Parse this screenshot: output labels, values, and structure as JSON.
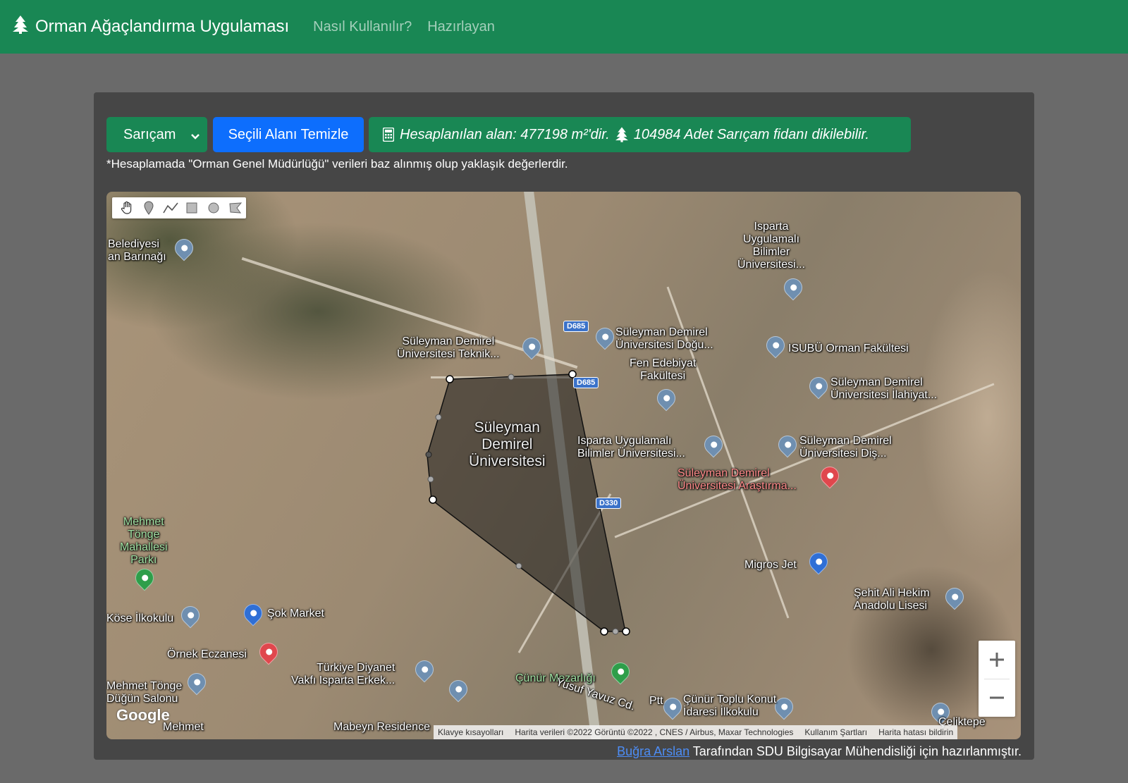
{
  "navbar": {
    "brand": "Orman Ağaçlandırma Uygulaması",
    "brand_icon": "tree-icon",
    "links": [
      "Nasıl Kullanılır?",
      "Hazırlayan"
    ],
    "color": "#198754"
  },
  "controls": {
    "species_selected": "Sarıçam",
    "clear_button": "Seçili Alanı Temizle",
    "info_area_text": "Hesaplanılan alan: 477198 m²'dir.",
    "info_count_text": "104984 Adet Sarıçam fidanı dikilebilir.",
    "info_icons": [
      "calculator-icon",
      "tree-icon"
    ],
    "note": "*Hesaplamada \"Orman Genel Müdürlüğü\" verileri baz alınmış olup yaklaşık değerlerdir."
  },
  "map": {
    "draw_tools": [
      "hand-icon",
      "marker-icon",
      "polyline-icon",
      "rectangle-icon",
      "circle-icon",
      "polygon-icon"
    ],
    "labels": {
      "belediyesi": "Belediyesi\nan Barınağı",
      "isparta_uyg": "Isparta\nUygulamalı\nBilimler\nÜniversitesi...",
      "sdu_teknik": "Süleyman Demirel\nÜniversitesi Teknik...",
      "sdu_dogu": "Süleyman Demirel\nÜniversitesi Doğu...",
      "isubu_orman": "ISUBÜ Orman Fakültesi",
      "fen_edebiyat": "Fen Edebiyat\nFakültesi",
      "sdu_ilahiyat": "Süleyman Demirel\nÜniversitesi İlahiyat...",
      "sdu_main": "Süleyman\nDemirel\nÜniversitesi",
      "isparta_uyg2": "Isparta Uygulamalı\nBilimler Üniversitesi...",
      "sdu_dis": "Süleyman Demirel\nÜniversitesi Diş...",
      "sdu_arastirma": "Süleyman Demirel\nÜniversitesi Araştırma...",
      "mehmet_tonge_park": "Mehmet\nTönge\nMahallesi\nParkı",
      "migros": "Migros Jet",
      "sehit_ali": "Şehit Ali Hekim\nAnadolu Lisesi",
      "kose_ilkokulu": "Köse İlkokulu",
      "sok_market": "Şok Market",
      "ornek_eczanesi": "Örnek Eczanesi",
      "turkiye_diyanet": "Türkiye Diyanet\nVakfı Isparta Erkek...",
      "cunur_mezarligi": "Çünür Mezarlığı",
      "mehmet_tonge_dugun": "Mehmet Tönge\nDüğün Salonu",
      "yusuf_yavuz": "Yusuf Yavuz Cd.",
      "ptt": "Ptt",
      "cunur_toplu": "Çünür Toplu Konut\nİdaresi İlkokulu",
      "celiktepe": "Çeliktepe",
      "mabeyn": "Mabeyn Residence",
      "mehmet_bottom": "Mehmet",
      "d685_a": "D685",
      "d685_b": "D685",
      "d330": "D330"
    },
    "zoom_in": "+",
    "zoom_out": "−",
    "google_logo": "Google",
    "attribution": [
      "Klavye kısayolları",
      "Harita verileri ©2022 Görüntü ©2022 , CNES / Airbus, Maxar Technologies",
      "Kullanım Şartları",
      "Harita hatası bildirin"
    ]
  },
  "footer": {
    "author_link": "Buğra Arslan",
    "text": " Tarafından SDU Bilgisayar Mühendisliği için hazırlanmıştır."
  }
}
